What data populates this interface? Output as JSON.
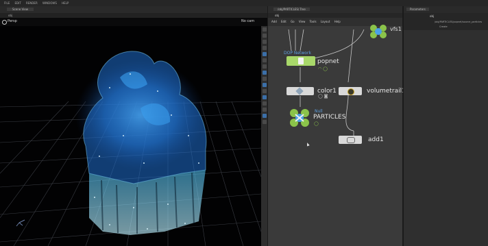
{
  "menubar": {
    "items": [
      "FILE",
      "EDIT",
      "RENDER",
      "WINDOWS",
      "HELP"
    ]
  },
  "viewport": {
    "tab": "Scene View",
    "path": "obj",
    "view_label": "Persp",
    "cam_label": "No cam"
  },
  "network": {
    "tab": "/obj/PARTICLES/ Tree",
    "path": "obj",
    "menu": [
      "Add",
      "Edit",
      "Go",
      "View",
      "Tools",
      "Layout",
      "Help"
    ],
    "nodes": {
      "popnet": {
        "label": "popnet",
        "type": "DOP Network"
      },
      "color1": {
        "label": "color1"
      },
      "volumetrail1": {
        "label": "volumetrail1"
      },
      "particles": {
        "label": "PARTICLES",
        "type": "Null"
      },
      "add1": {
        "label": "add1"
      },
      "vfs": {
        "label": "vfs1"
      }
    }
  },
  "params": {
    "tab": "Parameters",
    "path": "obj",
    "rows": [
      "/obj/PARTICLES/popnet/source_particles",
      "Create"
    ]
  }
}
